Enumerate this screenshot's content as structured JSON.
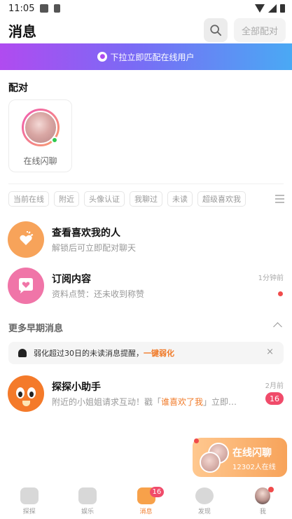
{
  "status_bar": {
    "time": "11:05"
  },
  "header": {
    "title": "消息",
    "all_match_label": "全部配对"
  },
  "banner": {
    "text": "下拉立即匹配在线用户"
  },
  "match_section": {
    "label": "配对",
    "card_label": "在线闪聊"
  },
  "filters": [
    "当前在线",
    "附近",
    "头像认证",
    "我聊过",
    "未读",
    "超级喜欢我"
  ],
  "rows": [
    {
      "title": "查看喜欢我的人",
      "subtitle": "解锁后可立即配对聊天",
      "time": "",
      "icon": "heart-fire-icon",
      "color": "#f7a35a"
    },
    {
      "title": "订阅内容",
      "subtitle": "资料点赞：还未收到称赞",
      "time": "1分钟前",
      "icon": "heart-chat-icon",
      "color": "#f075a8"
    }
  ],
  "more_section": {
    "label": "更多早期消息"
  },
  "notice": {
    "text": "弱化超过30日的未读消息提醒，",
    "link": "一键弱化",
    "close": "×"
  },
  "assistant": {
    "title": "探探小助手",
    "subtitle_prefix": "附近的小姐姐请求互动！戳「",
    "subtitle_quote": "谁喜欢了我",
    "subtitle_suffix": "」立即…",
    "time": "2月前",
    "badge": "16"
  },
  "float_card": {
    "title": "在线闪聊",
    "subtitle": "12302人在线"
  },
  "tabbar": [
    {
      "label": "探探",
      "icon": "cards-icon",
      "badge": ""
    },
    {
      "label": "娱乐",
      "icon": "tv-icon",
      "badge": ""
    },
    {
      "label": "消息",
      "icon": "message-icon",
      "badge": "16"
    },
    {
      "label": "发现",
      "icon": "compass-icon",
      "badge": ""
    },
    {
      "label": "我",
      "icon": "avatar-icon",
      "badge": ""
    }
  ],
  "colors": {
    "accent": "#f07a28",
    "badge": "#f04b6a",
    "online": "#2dc84d"
  }
}
